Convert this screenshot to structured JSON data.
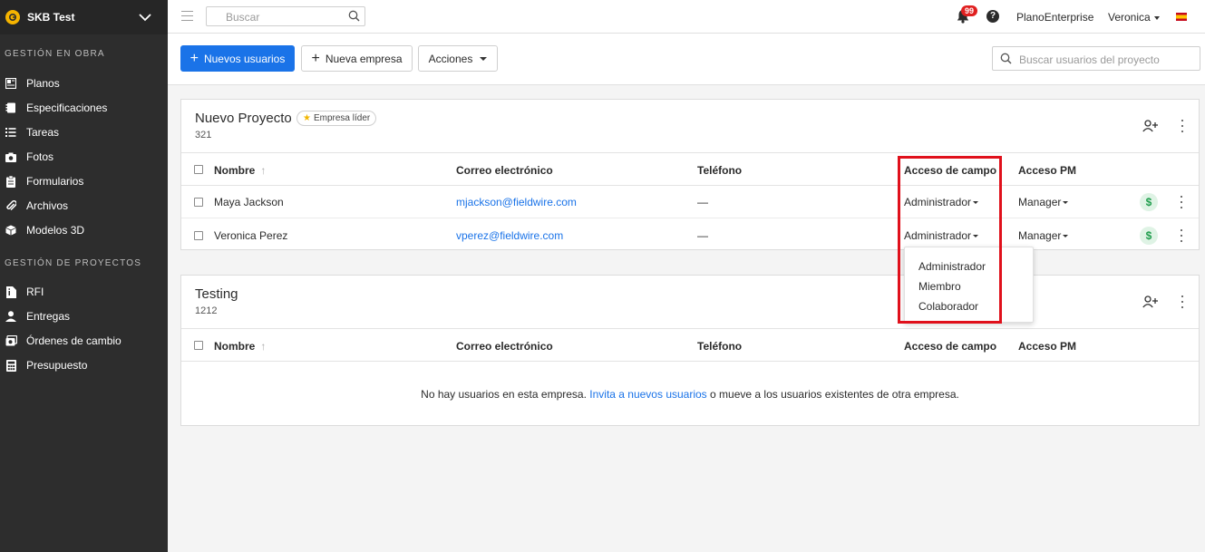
{
  "sidebar": {
    "project_name": "SKB Test",
    "section_obra": "GESTIÓN EN OBRA",
    "obra_items": [
      {
        "label": "Planos",
        "icon": "plans-icon"
      },
      {
        "label": "Especificaciones",
        "icon": "specifications-icon"
      },
      {
        "label": "Tareas",
        "icon": "tasks-icon"
      },
      {
        "label": "Fotos",
        "icon": "camera-icon"
      },
      {
        "label": "Formularios",
        "icon": "clipboard-icon"
      },
      {
        "label": "Archivos",
        "icon": "paperclip-icon"
      },
      {
        "label": "Modelos 3D",
        "icon": "cube-icon"
      }
    ],
    "section_proyectos": "GESTIÓN DE PROYECTOS",
    "proyectos_items": [
      {
        "label": "RFI",
        "icon": "rfi-icon"
      },
      {
        "label": "Entregas",
        "icon": "person-icon"
      },
      {
        "label": "Órdenes de cambio",
        "icon": "change-order-icon"
      },
      {
        "label": "Presupuesto",
        "icon": "calculator-icon"
      }
    ]
  },
  "topbar": {
    "search_placeholder": "Buscar",
    "notifications_count": "99",
    "help_glyph": "?",
    "plan": "PlanoEnterprise",
    "user": "Veronica",
    "language_flag": "spain-flag-icon"
  },
  "actions": {
    "new_users": "Nuevos usuarios",
    "new_company": "Nueva empresa",
    "actions": "Acciones",
    "search_users_placeholder": "Buscar usuarios del proyecto"
  },
  "table_headers": {
    "name": "Nombre",
    "email": "Correo electrónico",
    "phone": "Teléfono",
    "field_access": "Acceso de campo",
    "pm_access": "Acceso PM"
  },
  "companies": [
    {
      "name": "Nuevo Proyecto",
      "badge": "Empresa líder",
      "count": "321",
      "rows": [
        {
          "name": "Maya Jackson",
          "email": "mjackson@fieldwire.com",
          "phone": "—",
          "field_access": "Administrador",
          "pm_access": "Manager"
        },
        {
          "name": "Veronica Perez",
          "email": "vperez@fieldwire.com",
          "phone": "—",
          "field_access": "Administrador",
          "pm_access": "Manager"
        }
      ]
    },
    {
      "name": "Testing",
      "count": "1212",
      "empty_before": "No hay usuarios en esta empresa.",
      "empty_link": "Invita a nuevos usuarios",
      "empty_after": "o mueve a los usuarios existentes de otra empresa."
    }
  ],
  "field_access_menu": {
    "options": [
      "Administrador",
      "Miembro",
      "Colaborador"
    ]
  },
  "colors": {
    "primary": "#1a73e8",
    "sidebar": "#2d2d2d",
    "highlight": "#e0101b",
    "badge": "#e02020"
  }
}
